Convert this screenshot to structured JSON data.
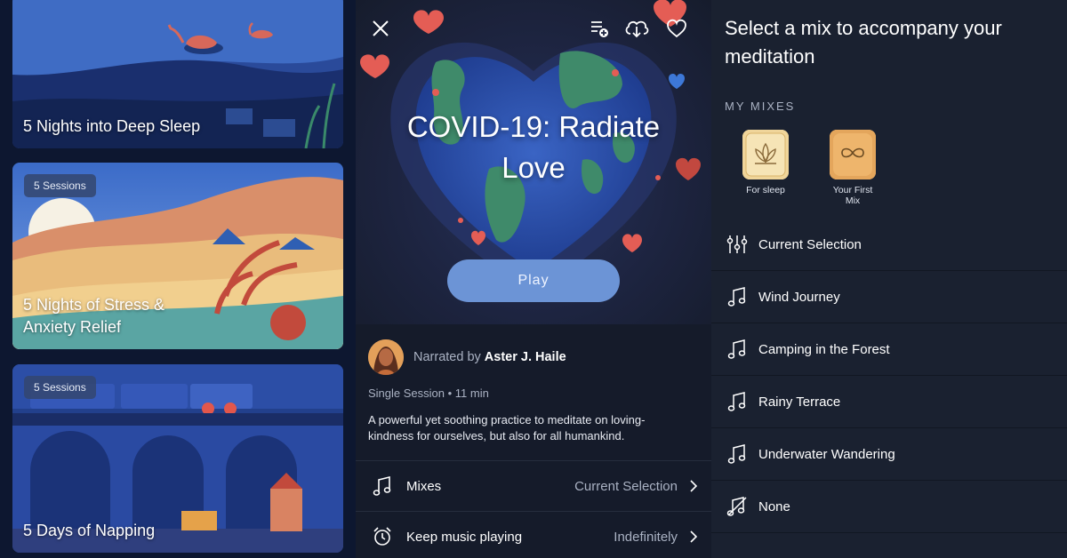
{
  "left": {
    "cards": [
      {
        "title": "5 Nights into Deep Sleep",
        "badge": ""
      },
      {
        "title": "5 Nights of Stress &\nAnxiety Relief",
        "badge": "5 Sessions"
      },
      {
        "title": "5 Days of Napping",
        "badge": "5 Sessions"
      }
    ]
  },
  "player": {
    "title": "COVID-19: Radiate\nLove",
    "play_label": "Play",
    "narrator_prefix": "Narrated by",
    "narrator_name": "Aster J. Haile",
    "session_meta": "Single Session • 11 min",
    "description": "A powerful yet soothing practice to meditate on loving-kindness for ourselves, but also for all humankind.",
    "settings": [
      {
        "label": "Mixes",
        "value": "Current Selection",
        "icon": "music-note-icon"
      },
      {
        "label": "Keep music playing",
        "value": "Indefinitely",
        "icon": "alarm-clock-icon"
      }
    ],
    "icons": [
      "close-icon",
      "add-to-queue-icon",
      "download-icon",
      "heart-icon"
    ]
  },
  "mix_panel": {
    "heading": "Select a mix to accompany your meditation",
    "my_mixes_label": "MY MIXES",
    "my_mixes": [
      {
        "label": "For sleep",
        "icon": "lotus-icon"
      },
      {
        "label": "Your First\nMix",
        "icon": "infinity-icon"
      }
    ],
    "options": [
      {
        "label": "Current Selection",
        "icon": "sliders-icon"
      },
      {
        "label": "Wind Journey",
        "icon": "music-note-icon"
      },
      {
        "label": "Camping in the Forest",
        "icon": "music-note-icon"
      },
      {
        "label": "Rainy Terrace",
        "icon": "music-note-icon"
      },
      {
        "label": "Underwater Wandering",
        "icon": "music-note-icon"
      },
      {
        "label": "None",
        "icon": "music-off-icon"
      }
    ]
  },
  "colors": {
    "play_button": "#6c94d6",
    "background": "#151b2a",
    "panel_right": "#1a2130"
  }
}
